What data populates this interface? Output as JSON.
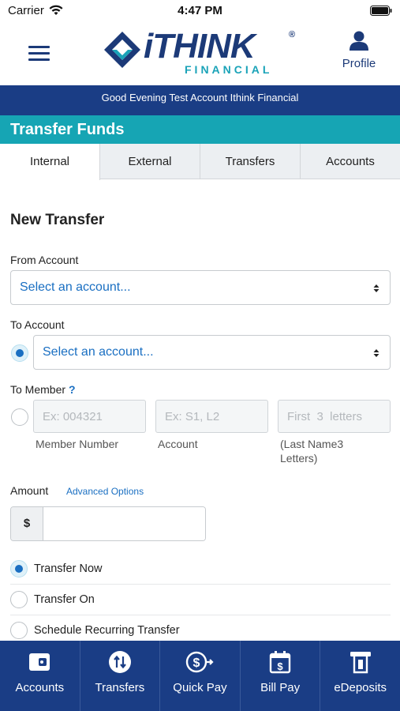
{
  "status_bar": {
    "carrier": "Carrier",
    "time": "4:47 PM"
  },
  "header": {
    "logo_text": "iTHINK",
    "logo_subtext": "FINANCIAL",
    "logo_reg_mark": "®",
    "profile_label": "Profile"
  },
  "greeting": "Good Evening Test Account Ithink Financial",
  "page_title": "Transfer Funds",
  "tabs": [
    {
      "label": "Internal",
      "active": true
    },
    {
      "label": "External",
      "active": false
    },
    {
      "label": "Transfers",
      "active": false
    },
    {
      "label": "Accounts",
      "active": false
    }
  ],
  "form": {
    "section_title": "New Transfer",
    "from_account": {
      "label": "From Account",
      "value": "Select an account..."
    },
    "to_account": {
      "label": "To Account",
      "value": "Select an account...",
      "selected": true
    },
    "to_member": {
      "label": "To Member",
      "help": "?",
      "selected": false,
      "member_number": {
        "placeholder": "Ex: 004321",
        "hint": "Member Number"
      },
      "account": {
        "placeholder": "Ex: S1, L2",
        "hint": "Account"
      },
      "last_name": {
        "placeholder": "First  3  letters",
        "hint_line1": "(Last Name3",
        "hint_line2": "Letters)"
      }
    },
    "amount": {
      "label": "Amount",
      "advanced_link": "Advanced Options",
      "currency": "$",
      "value": ""
    },
    "timing_options": [
      {
        "label": "Transfer Now",
        "selected": true
      },
      {
        "label": "Transfer On",
        "selected": false
      },
      {
        "label": "Schedule Recurring Transfer",
        "selected": false
      }
    ]
  },
  "bottom_nav": [
    {
      "label": "Accounts",
      "icon": "wallet-icon"
    },
    {
      "label": "Transfers",
      "icon": "transfer-arrows-icon"
    },
    {
      "label": "Quick Pay",
      "icon": "dollar-send-icon"
    },
    {
      "label": "Bill Pay",
      "icon": "calendar-dollar-icon"
    },
    {
      "label": "eDeposits",
      "icon": "check-deposit-icon"
    }
  ],
  "colors": {
    "brand_navy": "#1a3d85",
    "brand_teal": "#16a5b4",
    "link_blue": "#1a6fc2"
  }
}
